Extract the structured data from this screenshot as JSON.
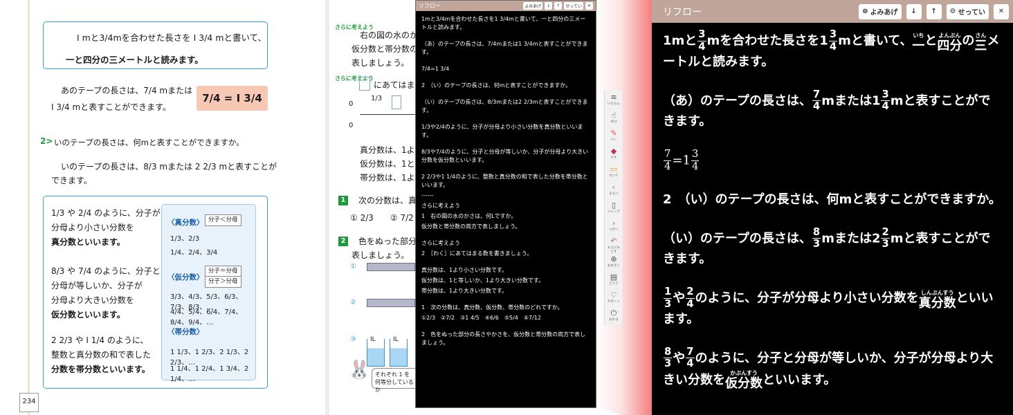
{
  "book": {
    "page_number": "234",
    "intro_line1": "I mと3/4mを合わせた長さを I 3/4 mと書いて、",
    "intro_line2": "一と四分の三メートルと読みます。",
    "a_line1": "あのテープの長さは、7/4 mまたは",
    "a_line2": "I 3/4 mと表すことができます。",
    "eq_badge": "7/4 = I 3/4",
    "q2": "いのテープの長さは、何mと表すことができますか。",
    "b_line1": "いのテープの長さは、8/3 mまたは 2 2/3 mと表すことが",
    "b_line2": "できます。",
    "kinds_text1": [
      "1/3 や 2/4 のように、分子が",
      "分母より小さい分数を",
      "真分数といいます。"
    ],
    "kinds_text2": [
      "8/3 や 7/4 のように、分子と",
      "分母が等しいか、分子が",
      "分母より大きい分数を",
      "仮分数といいます。"
    ],
    "kinds_text3": [
      "2 2/3 や I 1/4 のように、",
      "整数と真分数の和で表した",
      "分数を帯分数といいます。"
    ],
    "panel_proper_head": "〈真分数〉",
    "panel_proper_tag": "分子＜分母",
    "panel_proper_rows": [
      "1/3、2/3",
      "1/4、2/4、3/4"
    ],
    "panel_improper_head": "〈仮分数〉",
    "panel_improper_tag1": "分子＝分母",
    "panel_improper_tag2": "分子＞分母",
    "panel_improper_rows": [
      "3/3、4/3、5/3、6/3、7/3、8/3、…",
      "4/4、5/4、6/4、7/4、8/4、9/4、…"
    ],
    "panel_mixed_head": "〈帯分数〉",
    "panel_mixed_rows": [
      "1 1/3、1 2/3、2 1/3、2 2/3、…",
      "1 1/4、1 2/4、1 3/4、2 1/4、…"
    ],
    "rp_more1": "さらに考えよう",
    "rp_text1": "右の図の水のか",
    "rp_text1b": "仮分数と帯分数の",
    "rp_text1c": "表しましょう。",
    "rp_more2": "さらに考えよう",
    "rp_text2": "にあてはま",
    "rp_nl_0": "0",
    "rp_nl_frac": "1/3",
    "rp_nl_0b": "0",
    "rp_def1": "真分数は、1よ",
    "rp_def2": "仮分数は、1と",
    "rp_def3": "帯分数は、1よ",
    "rp_q1": "次の分数は、真分",
    "rp_q1_items": "① 2/3　　② 7/2",
    "rp_q2": "色をぬった部分の",
    "rp_q2b": "表しましょう。",
    "rp_cup_label": "IL",
    "rp_bubble": "それぞれ 1 を何等分しているか"
  },
  "mini": {
    "title": "リフロー",
    "btn_read": "よみあげ",
    "btn_down": "↓",
    "btn_up": "↑",
    "btn_settings": "せってい",
    "btn_close": "✕",
    "paras": [
      "1mと3/4mを合わせた長さを1 3/4mと書いて、一と四分の三メートルと読みます。",
      "（あ）のテープの長さは、7/4mまたは1 3/4mと表すことができます。",
      "7/4=1 3/4",
      "2　（い）のテープの長さは、何mと表すことができますか。",
      "（い）のテープの長さは、8/3mまたは2 2/3mと表すことができます。",
      "1/3や2/4のように、分子が分母より小さい分数を真分数といいます。",
      "8/3や7/4のように、分子と分母が等しいか、分子が分母より大きい分数を仮分数といいます。",
      "2 2/3や1 1/4のように、整数と真分数の和で表した分数を帯分数といいます。"
    ],
    "divider": "------",
    "more1_a": "さらに考えよう",
    "more1_b": "1　右の図の水のかさは、何Lですか。",
    "more1_c": "仮分数と帯分数の両方で表しましょう。",
    "more2_a": "さらに考えよう",
    "more2_b": "2　［わく］にあてはまる数を書きましょう。",
    "def_a": "真分数は、1より小さい分数です。",
    "def_b": "仮分数は、1と等しいか、1より大きい分数です。",
    "def_c": "帯分数は、1より大きい分数です。",
    "q1": "1　次の分数は、真分数、仮分数、帯分数のどれですか。",
    "q1_items": "①2/3　②7/2　③1 4/5　④6/6　⑤5/4　⑥7/12",
    "q2": "2　色をぬった部分の長さやかさを、仮分数と帯分数の両方で表しましょう。"
  },
  "toolbar": [
    {
      "icon": "≡",
      "label": "いちらん",
      "name": "tool-list"
    },
    {
      "icon": "☝",
      "label": "ゆび",
      "name": "tool-finger"
    },
    {
      "icon": "✎",
      "label": "ペン",
      "name": "tool-pen"
    },
    {
      "icon": "◆",
      "label": "けす",
      "name": "tool-eraser"
    },
    {
      "icon": "▭",
      "label": "せいり",
      "name": "tool-sticky"
    },
    {
      "icon": "‹",
      "label": "まえへ",
      "name": "tool-prev"
    },
    {
      "icon": "▯",
      "label": "ジャンプ",
      "name": "tool-jump"
    },
    {
      "icon": "›",
      "label": "つぎへ",
      "name": "tool-next"
    },
    {
      "icon": "↶",
      "label": "もとにもどす",
      "name": "tool-undo"
    },
    {
      "icon": "⊕",
      "label": "おおきく",
      "name": "tool-zoom"
    },
    {
      "icon": "▤",
      "label": "どうぐ",
      "name": "tool-tools"
    },
    {
      "icon": "♡",
      "label": "サポート",
      "name": "tool-support"
    },
    {
      "icon": "⏻",
      "label": "おわる",
      "name": "tool-exit"
    }
  ],
  "big": {
    "title": "リフロー",
    "btn_read": "よみあげ",
    "btn_down": "↓",
    "btn_up": "↑",
    "btn_settings": "せってい",
    "btn_close": "✕",
    "p1_pre": "1mと",
    "p1_f1n": "3",
    "p1_f1d": "4",
    "p1_mid": "mを合わせた長さを1",
    "p1_f2n": "3",
    "p1_f2d": "4",
    "p1_post1": "mと書いて、",
    "p1_r1": "一",
    "p1_r1t": "いち",
    "p1_and": "と",
    "p1_r2": "四分",
    "p1_r2t": "よんぶん",
    "p1_no": "の",
    "p1_r3": "三",
    "p1_r3t": "さん",
    "p1_post2": "メートルと読みます。",
    "p2_pre": "（あ）のテープの長さは、",
    "p2_f1n": "7",
    "p2_f1d": "4",
    "p2_mid": "mまたは1",
    "p2_f2n": "3",
    "p2_f2d": "4",
    "p2_post": "mと表すことができます。",
    "p3_f1n": "7",
    "p3_f1d": "4",
    "p3_eq": "=1",
    "p3_f2n": "3",
    "p3_f2d": "4",
    "p4": "2　（い）のテープの長さは、何mと表すことができますか。",
    "p5_pre": "（い）のテープの長さは、",
    "p5_f1n": "8",
    "p5_f1d": "3",
    "p5_mid": "mまたは2",
    "p5_f2n": "2",
    "p5_f2d": "3",
    "p5_post": "mと表すことができます。",
    "p6_f1n": "1",
    "p6_f1d": "3",
    "p6_ya": "や",
    "p6_f2n": "2",
    "p6_f2d": "4",
    "p6_mid": "のように、分子が分母より小さい分数を",
    "p6_r": "真分数",
    "p6_rt": "しんぶんすう",
    "p6_post": "といいます。",
    "p7_f1n": "8",
    "p7_f1d": "3",
    "p7_ya": "や",
    "p7_f2n": "7",
    "p7_f2d": "4",
    "p7_mid": "のように、分子と分母が等しいか、分子が分母より大きい分数を",
    "p7_r": "仮分数",
    "p7_rt": "かぶんすう",
    "p7_post": "といいます。"
  }
}
